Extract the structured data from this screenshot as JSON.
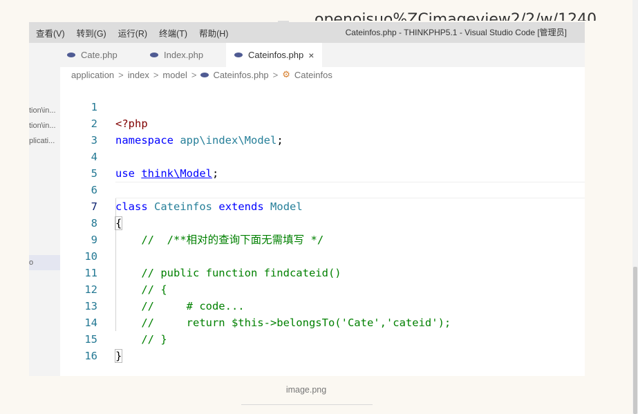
{
  "page_header_clip": "openoisuo%ZCimageview2/2/w/1240",
  "menu": [
    "查看(V)",
    "转到(G)",
    "运行(R)",
    "终端(T)",
    "帮助(H)"
  ],
  "window_title": "Cateinfos.php - THINKPHP5.1 - Visual Studio Code [管理员]",
  "sidebar_items": [
    "tion\\in...",
    "tion\\in...",
    "plicati...",
    "o"
  ],
  "tabs": [
    {
      "label": "Cate.php",
      "active": false
    },
    {
      "label": "Index.php",
      "active": false
    },
    {
      "label": "Cateinfos.php",
      "active": true,
      "close": "×"
    }
  ],
  "breadcrumb": {
    "parts": [
      "application",
      "index",
      "model",
      "Cateinfos.php",
      "Cateinfos"
    ],
    "sep": ">"
  },
  "code_lines": [
    {
      "n": "1",
      "t": "<?php"
    },
    {
      "n": "2",
      "t": "namespace app\\index\\Model;"
    },
    {
      "n": "3",
      "t": ""
    },
    {
      "n": "4",
      "t": "use think\\Model;"
    },
    {
      "n": "5",
      "t": ""
    },
    {
      "n": "6",
      "t": "class Cateinfos extends Model"
    },
    {
      "n": "7",
      "t": "{"
    },
    {
      "n": "8",
      "t": "    //  /**相对的查询下面无需填写 */"
    },
    {
      "n": "9",
      "t": ""
    },
    {
      "n": "10",
      "t": "    // public function findcateid()"
    },
    {
      "n": "11",
      "t": "    // {"
    },
    {
      "n": "12",
      "t": "    //     # code..."
    },
    {
      "n": "13",
      "t": "    //     return $this->belongsTo('Cate','cateid');"
    },
    {
      "n": "14",
      "t": "    // }"
    },
    {
      "n": "15",
      "t": "}"
    },
    {
      "n": "16",
      "t": ""
    }
  ],
  "tokens": {
    "php_open": "<?php",
    "namespace_kw": "namespace",
    "namespace_path": "app\\index\\Model",
    "use_kw": "use",
    "use_path": "think\\Model",
    "class_kw": "class",
    "class_name": "Cateinfos",
    "extends_kw": "extends",
    "parent": "Model",
    "semicolon": ";",
    "open_brace": "{",
    "close_brace": "}",
    "c8": "    //  /**相对的查询下面无需填写 */",
    "c10": "    // public function findcateid()",
    "c11": "    // {",
    "c12": "    //     # code...",
    "c13": "    //     return $this->belongsTo('Cate','cateid');",
    "c14": "    // }"
  },
  "caption": "image.png",
  "colors": {
    "keyword": "#0000ff",
    "type": "#267f99",
    "comment": "#008000",
    "line_number": "#237893",
    "php_tag": "#800000"
  }
}
